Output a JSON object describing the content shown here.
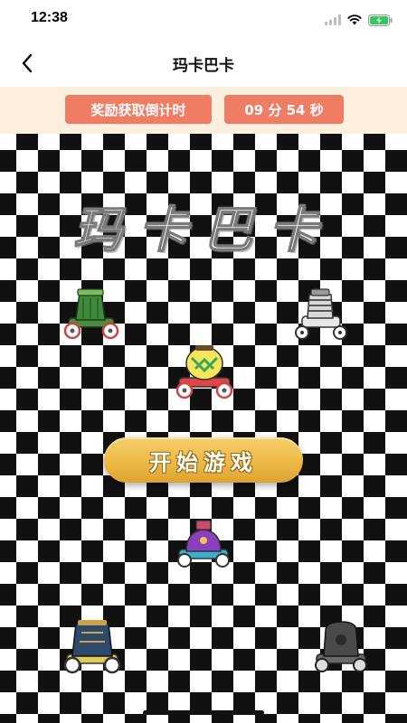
{
  "status_bar": {
    "time": "12:38"
  },
  "nav": {
    "title": "玛卡巴卡"
  },
  "reward": {
    "label": "奖励获取倒计时",
    "countdown": "09 分 54 秒"
  },
  "game": {
    "title": "玛卡巴卡",
    "start_label": "开始游戏"
  },
  "icons": {
    "back": "back-arrow-icon",
    "signal": "cellular-signal-icon",
    "wifi": "wifi-icon",
    "battery": "battery-charging-icon"
  },
  "colors": {
    "reward_pill": "#ef7d64",
    "reward_strip": "#fbf0e0",
    "start_button": "#ecb743",
    "checker_dark": "#111111",
    "checker_light": "#ffffff",
    "battery": "#34c759"
  }
}
